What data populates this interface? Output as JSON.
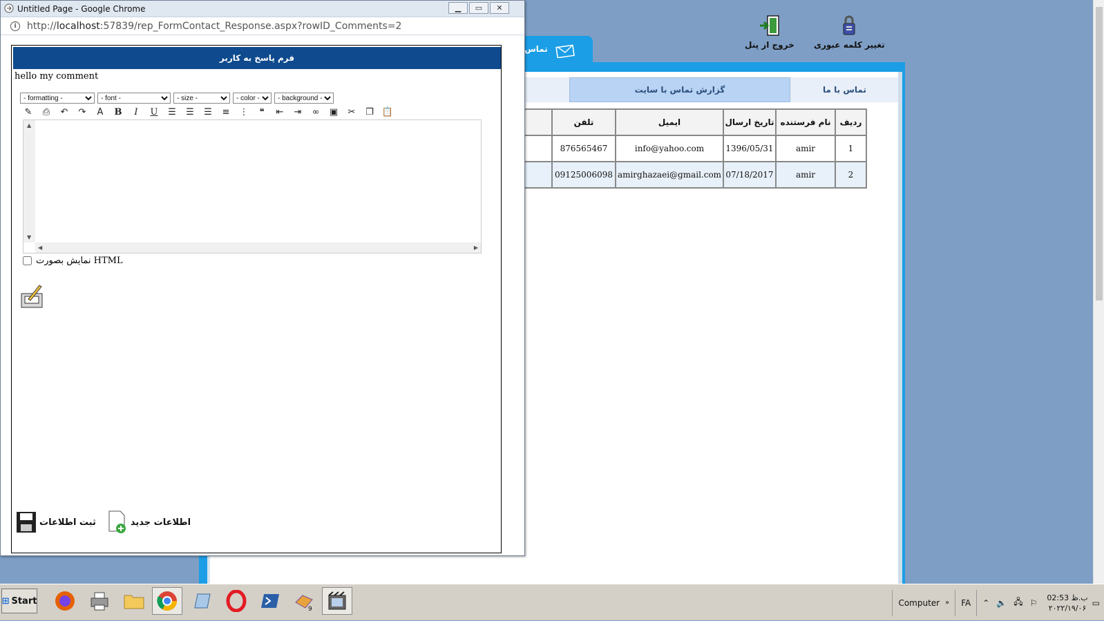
{
  "popup": {
    "window_title": "Untitled Page - Google Chrome",
    "url_prefix": "http://",
    "url_host": "localhost",
    "url_rest": ":57839/rep_FormContact_Response.aspx?rowID_Comments=2",
    "form_title": "فرم پاسخ به کاربر",
    "comment_text": "hello my comment",
    "selects": [
      "- formatting -",
      "- font -",
      "- size -",
      "- color -",
      "- background -"
    ],
    "html_toggle_label": "نمایش بصورت HTML",
    "save_label": "ثبت اطلاعات",
    "new_label": "اطلاعات جدید"
  },
  "header": {
    "change_password_label": "تغییر کلمه عبوری",
    "logout_label": "خروج از پنل",
    "tab_contact_label": "تماس با"
  },
  "inner_tabs": {
    "report_label": "گزارش تماس با سایت",
    "contactus_label": "تماس با ما"
  },
  "table": {
    "headers": [
      "ردیف",
      "نام فرستنده",
      "تاریخ ارسال",
      "ایمیل",
      "تلفن"
    ],
    "rows": [
      [
        "1",
        "amir",
        "1396/05/31",
        "info@yahoo.com",
        "876565467"
      ],
      [
        "2",
        "amir",
        "07/18/2017",
        "amirghazaei@gmail.com",
        "09125006098"
      ]
    ]
  },
  "taskbar": {
    "start_label": "Start",
    "computer_label": "Computer",
    "lang_label": "FA",
    "clock_time": "02:53 ب.ظ",
    "clock_date": "۲۰۲۲/۱۹/۰۶"
  },
  "colors": {
    "page_bg": "#7e9ec5",
    "accent_blue": "#1b9ee6",
    "form_title_bg": "#0e4a8d",
    "selected_tab_bg": "#b8d3f3"
  }
}
